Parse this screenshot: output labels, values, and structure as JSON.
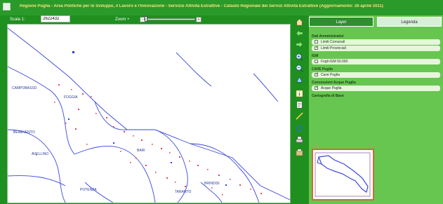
{
  "header": {
    "title": "Regione Puglia - Area Politiche per lo Sviluppo, il Lavoro e l'Innovazione - Servizio Attività Estrattive - Catasto Regionale dei Servizi Attività Estrattive (Aggiornamento: 28 aprile 2011)"
  },
  "controls": {
    "scale_label": "Scala 1:",
    "scale_value": "2622432",
    "zoom_label": "Zoom +",
    "zoom_minus": "-",
    "zoom_plus": "+"
  },
  "zoom": {
    "level": 0.02
  },
  "map_labels": [
    {
      "text": "CAMPOBASSO"
    },
    {
      "text": "FOGGIA"
    },
    {
      "text": "BENEVENTO"
    },
    {
      "text": "AVELLINO"
    },
    {
      "text": "BARI"
    },
    {
      "text": "BRINDISI"
    },
    {
      "text": "POTENZA"
    },
    {
      "text": "TARANTO"
    }
  ],
  "panel": {
    "tab_layer": "Layer",
    "tab_legend": "Legenda",
    "groups": [
      {
        "title": "Dati Amministrativi",
        "items": [
          {
            "label": "Limiti Comunali",
            "checked": false
          },
          {
            "label": "Limiti Provinciali",
            "checked": true
          }
        ]
      },
      {
        "title": "IGM",
        "items": [
          {
            "label": "Fogli IGM 50.000",
            "checked": false
          }
        ]
      },
      {
        "title": "CAVE Puglia",
        "items": [
          {
            "label": "Cave Puglia",
            "checked": true
          }
        ]
      },
      {
        "title": "Concessioni Acque Puglia",
        "items": [
          {
            "label": "Acque Puglia",
            "checked": true
          }
        ]
      },
      {
        "title": "Cartografia di Base",
        "items": []
      }
    ]
  },
  "colors": {
    "brand_green": "#2a9a2a",
    "panel_green": "#67c64f",
    "boundary_blue": "#3b48d9",
    "quarry_red": "#e0454f"
  },
  "icons": [
    "home-icon",
    "pan-left-arrow-icon",
    "pan-right-arrow-icon",
    "zoom-in-icon",
    "zoom-out-icon",
    "pan-hand-icon",
    "info-icon",
    "print-icon",
    "refresh-icon",
    "measure-icon"
  ]
}
